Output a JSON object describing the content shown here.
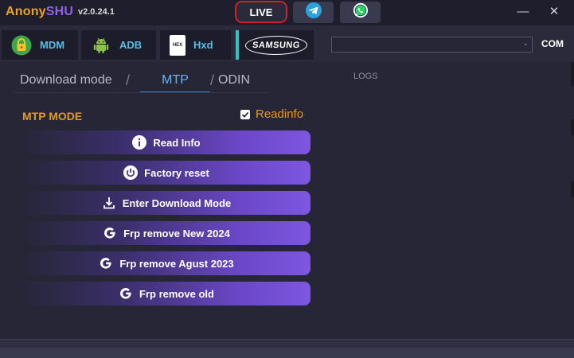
{
  "app": {
    "name_part1": "Anony",
    "name_part2": "SHU",
    "version": "v2.0.24.1"
  },
  "titlebar": {
    "live_label": "LIVE",
    "telegram_icon": "telegram-icon",
    "whatsapp_icon": "whatsapp-icon",
    "minimize_label": "—",
    "close_label": "✕"
  },
  "toolbar": {
    "mdm_label": "MDM",
    "adb_label": "ADB",
    "hxd_label": "Hxd",
    "hxd_icon_text": "HEX",
    "samsung_label": "SAMSUNG",
    "com_label": "COM",
    "com_value": ""
  },
  "tabs": {
    "download": "Download mode",
    "mtp": "MTP",
    "odin": "ODIN",
    "separator": "/"
  },
  "logs": {
    "label": "LOGS"
  },
  "mtp": {
    "title": "MTP MODE",
    "readinfo_label": "Readinfo",
    "readinfo_checked": true,
    "buttons": [
      {
        "label": "Read Info",
        "icon": "info-icon"
      },
      {
        "label": "Factory reset",
        "icon": "power-icon"
      },
      {
        "label": "Enter Download Mode",
        "icon": "download-icon"
      },
      {
        "label": "Frp remove New 2024",
        "icon": "google-icon"
      },
      {
        "label": "Frp remove Agust 2023",
        "icon": "google-icon"
      },
      {
        "label": "Frp remove old",
        "icon": "google-icon"
      }
    ]
  },
  "colors": {
    "accent_orange": "#e39a1d",
    "accent_purple": "#7d57e0",
    "tab_active": "#6db2ec",
    "live_border": "#d11f2a",
    "tool_text": "#56c0e6"
  }
}
